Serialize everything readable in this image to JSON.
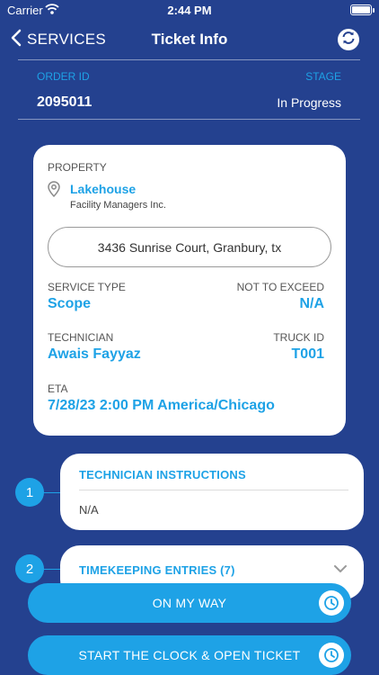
{
  "status_bar": {
    "carrier": "Carrier",
    "time": "2:44 PM"
  },
  "nav": {
    "back_label": "SERVICES",
    "title": "Ticket Info"
  },
  "order": {
    "order_id_label": "ORDER ID",
    "order_id": "2095011",
    "stage_label": "STAGE",
    "stage": "In Progress"
  },
  "property": {
    "label": "PROPERTY",
    "name": "Lakehouse",
    "company": "Facility Managers Inc.",
    "address": "3436 Sunrise Court, Granbury, tx"
  },
  "service": {
    "service_type_label": "SERVICE TYPE",
    "service_type": "Scope",
    "nte_label": "NOT TO EXCEED",
    "nte": "N/A",
    "technician_label": "TECHNICIAN",
    "technician": "Awais Fayyaz",
    "truck_label": "TRUCK ID",
    "truck": "T001",
    "eta_label": "ETA",
    "eta": "7/28/23 2:00 PM America/Chicago"
  },
  "steps": [
    {
      "number": "1",
      "title": "TECHNICIAN INSTRUCTIONS",
      "body": "N/A"
    },
    {
      "number": "2",
      "title": "TIMEKEEPING ENTRIES (7)"
    }
  ],
  "actions": {
    "on_my_way": "ON MY WAY",
    "start_clock": "START THE CLOCK & OPEN TICKET"
  },
  "colors": {
    "background": "#24418f",
    "accent": "#1ea2e6",
    "card": "#ffffff"
  },
  "icons": [
    "wifi-icon",
    "battery-icon",
    "chevron-left-icon",
    "refresh-icon",
    "location-pin-icon",
    "chevron-down-icon",
    "clock-icon"
  ]
}
